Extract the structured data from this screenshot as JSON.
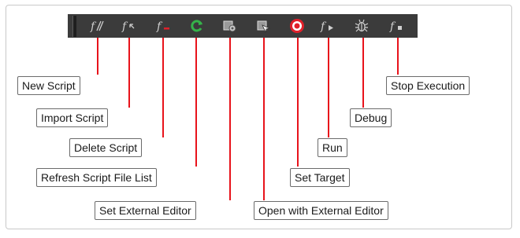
{
  "toolbar": {
    "buttons": [
      {
        "icon": "new-script-icon",
        "glyph": "f/"
      },
      {
        "icon": "import-script-icon",
        "glyph": "f↖"
      },
      {
        "icon": "delete-script-icon",
        "glyph": "f-"
      },
      {
        "icon": "refresh-icon",
        "glyph": ""
      },
      {
        "icon": "set-external-editor-icon",
        "glyph": ""
      },
      {
        "icon": "open-external-editor-icon",
        "glyph": ""
      },
      {
        "icon": "set-target-icon",
        "glyph": ""
      },
      {
        "icon": "run-icon",
        "glyph": "f▸"
      },
      {
        "icon": "debug-icon",
        "glyph": ""
      },
      {
        "icon": "stop-execution-icon",
        "glyph": "f▪"
      }
    ]
  },
  "callouts": {
    "new_script": "New Script",
    "import_script": "Import Script",
    "delete_script": "Delete Script",
    "refresh_list": "Refresh Script File List",
    "set_external_editor": "Set External Editor",
    "open_external_editor": "Open with External Editor",
    "set_target": "Set Target",
    "run": "Run",
    "debug": "Debug",
    "stop_execution": "Stop Execution"
  },
  "colors": {
    "leader_line": "#e8131b",
    "toolbar_bg": "#3b3b3b",
    "refresh_green": "#35b34a",
    "target_red": "#e0202a"
  }
}
